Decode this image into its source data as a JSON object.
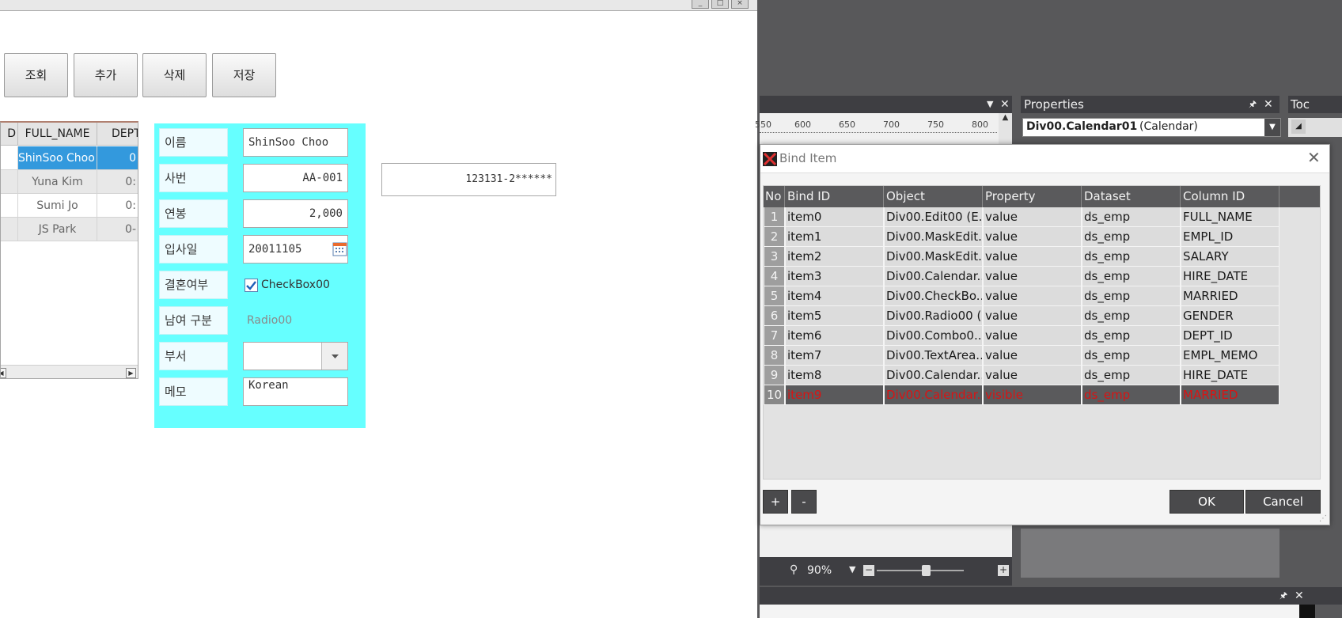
{
  "preview": {
    "window_buttons": [
      "_",
      "□",
      "×"
    ],
    "toolbar": [
      "조회",
      "추가",
      "삭제",
      "저장"
    ],
    "grid": {
      "columns": [
        "D",
        "FULL_NAME",
        "DEPT"
      ],
      "rows": [
        {
          "name": "ShinSoo Choo",
          "dept": "0"
        },
        {
          "name": "Yuna Kim",
          "dept": "0:"
        },
        {
          "name": "Sumi Jo",
          "dept": "0:"
        },
        {
          "name": "JS Park",
          "dept": "0-"
        }
      ],
      "scroll_left": "◀",
      "scroll_right": "▶"
    },
    "form": {
      "name_label": "이름",
      "name_value": "ShinSoo Choo",
      "id_label": "사번",
      "id_value": "AA-001",
      "salary_label": "연봉",
      "salary_value": "2,000",
      "hire_label": "입사일",
      "hire_value": "20011105",
      "married_label": "결혼여부",
      "married_text": "CheckBox00",
      "married_checked": true,
      "gender_label": "남여 구분",
      "gender_text": "Radio00",
      "dept_label": "부서",
      "dept_value": "",
      "memo_label": "메모",
      "memo_value": "Korean"
    },
    "ssn_value": "123131-2******"
  },
  "ide": {
    "ruler_labels": [
      "550",
      "600",
      "650",
      "700",
      "750",
      "800"
    ],
    "properties": {
      "title": "Properties",
      "object_name": "Div00.Calendar01",
      "object_type": "(Calendar)"
    },
    "toolbox_title": "Toc",
    "zoom": "90%",
    "pin_glyph": "🖈",
    "close_glyph": "✕"
  },
  "dialog": {
    "title": "Bind Item",
    "columns": [
      "No",
      "Bind ID",
      "Object",
      "Property",
      "Dataset",
      "Column ID"
    ],
    "rows": [
      {
        "no": "1",
        "bind_id": "item0",
        "object": "Div00.Edit00 (E...",
        "property": "value",
        "dataset": "ds_emp",
        "column_id": "FULL_NAME"
      },
      {
        "no": "2",
        "bind_id": "item1",
        "object": "Div00.MaskEdit...",
        "property": "value",
        "dataset": "ds_emp",
        "column_id": "EMPL_ID"
      },
      {
        "no": "3",
        "bind_id": "item2",
        "object": "Div00.MaskEdit...",
        "property": "value",
        "dataset": "ds_emp",
        "column_id": "SALARY"
      },
      {
        "no": "4",
        "bind_id": "item3",
        "object": "Div00.Calendar...",
        "property": "value",
        "dataset": "ds_emp",
        "column_id": "HIRE_DATE"
      },
      {
        "no": "5",
        "bind_id": "item4",
        "object": "Div00.CheckBo...",
        "property": "value",
        "dataset": "ds_emp",
        "column_id": "MARRIED"
      },
      {
        "no": "6",
        "bind_id": "item5",
        "object": "Div00.Radio00 (...",
        "property": "value",
        "dataset": "ds_emp",
        "column_id": "GENDER"
      },
      {
        "no": "7",
        "bind_id": "item6",
        "object": "Div00.Combo0...",
        "property": "value",
        "dataset": "ds_emp",
        "column_id": "DEPT_ID"
      },
      {
        "no": "8",
        "bind_id": "item7",
        "object": "Div00.TextArea...",
        "property": "value",
        "dataset": "ds_emp",
        "column_id": "EMPL_MEMO"
      },
      {
        "no": "9",
        "bind_id": "item8",
        "object": "Div00.Calendar...",
        "property": "value",
        "dataset": "ds_emp",
        "column_id": "HIRE_DATE"
      },
      {
        "no": "10",
        "bind_id": "item9",
        "object": "Div00.Calendar...",
        "property": "visible",
        "dataset": "ds_emp",
        "column_id": "MARRIED",
        "selected": true
      }
    ],
    "add_label": "+",
    "remove_label": "-",
    "ok_label": "OK",
    "cancel_label": "Cancel"
  }
}
